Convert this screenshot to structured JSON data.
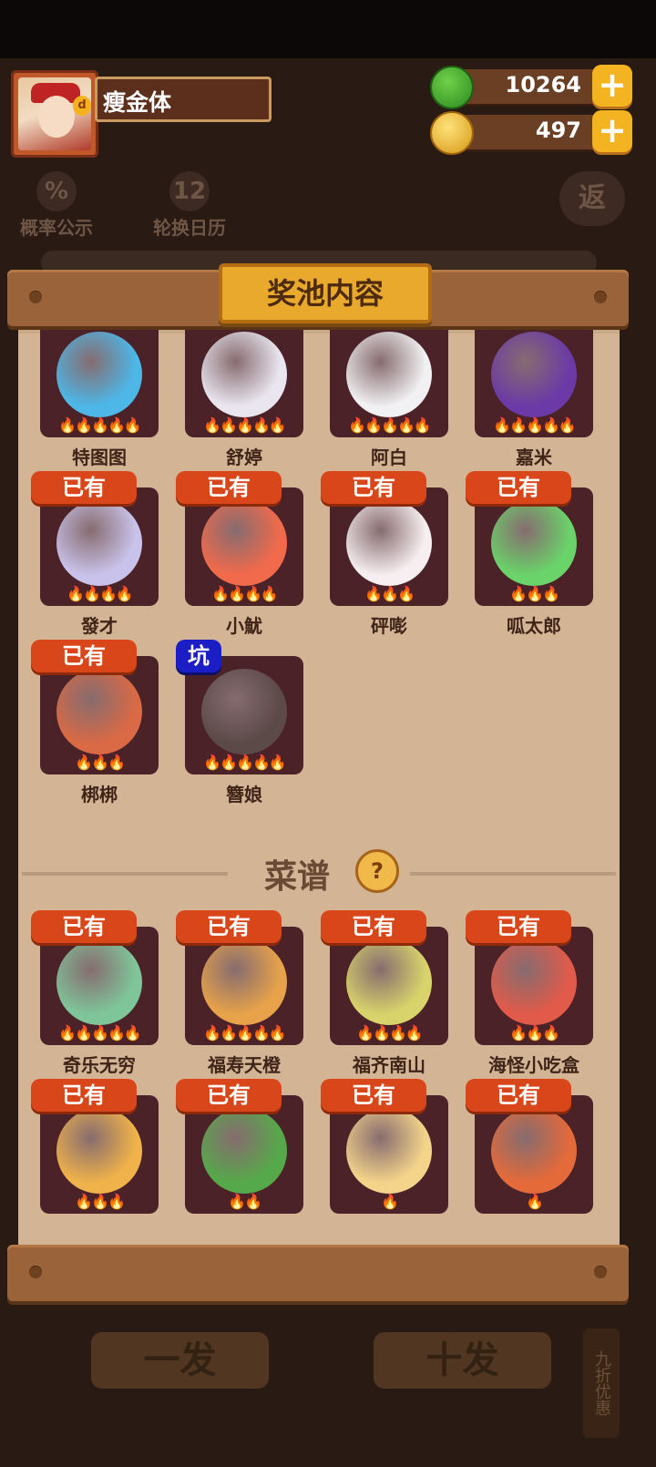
{
  "player": {
    "name": "瘦金体"
  },
  "currency": {
    "jade": {
      "value": "10264",
      "icon": "jade-coin-icon"
    },
    "coin": {
      "value": "497",
      "icon": "gold-coin-icon"
    },
    "add_symbol": "+"
  },
  "background_tools": {
    "rate": {
      "icon_text": "%",
      "label": "概率公示"
    },
    "calendar": {
      "icon_text": "12",
      "label": "轮换日历"
    },
    "back": {
      "label": "返"
    }
  },
  "background_buttons": {
    "single": "一发",
    "ten": "十发",
    "discount_tag": "九折优惠"
  },
  "modal": {
    "title": "奖池内容",
    "owned_tag": "已有",
    "pit_tag": "坑",
    "recipe_section_title": "菜谱",
    "help_symbol": "?",
    "characters": [
      {
        "name": "特图图",
        "owned": false,
        "stars": 5,
        "color": "#4db7e8"
      },
      {
        "name": "舒婷",
        "owned": false,
        "stars": 5,
        "color": "#eae6f0"
      },
      {
        "name": "阿白",
        "owned": false,
        "stars": 5,
        "color": "#f1f0f2"
      },
      {
        "name": "嘉米",
        "owned": false,
        "stars": 5,
        "color": "#6b3aa6"
      },
      {
        "name": "發才",
        "owned": true,
        "stars": 4,
        "color": "#c9c2ea"
      },
      {
        "name": "小魷",
        "owned": true,
        "stars": 4,
        "color": "#f26a4c"
      },
      {
        "name": "砰嘭",
        "owned": true,
        "stars": 3,
        "color": "#f6eef0"
      },
      {
        "name": "呱太郎",
        "owned": true,
        "stars": 3,
        "color": "#6ad36a"
      },
      {
        "name": "梆梆",
        "owned": true,
        "stars": 3,
        "color": "#d96a45"
      },
      {
        "name": "簪娘",
        "owned": false,
        "pit": true,
        "stars": 5,
        "color": "#5b4a48"
      }
    ],
    "recipes": [
      {
        "name": "奇乐无穷",
        "owned": true,
        "stars": 5,
        "color": "#7fc59a"
      },
      {
        "name": "福寿天橙",
        "owned": true,
        "stars": 5,
        "color": "#e7a24a"
      },
      {
        "name": "福齐南山",
        "owned": true,
        "stars": 4,
        "color": "#d9d36b"
      },
      {
        "name": "海怪小吃盒",
        "owned": true,
        "stars": 3,
        "color": "#e15a4a"
      },
      {
        "name": "",
        "owned": true,
        "stars": 3,
        "color": "#f0b24a"
      },
      {
        "name": "",
        "owned": true,
        "stars": 2,
        "color": "#56a94a"
      },
      {
        "name": "",
        "owned": true,
        "stars": 1,
        "color": "#f4d48a"
      },
      {
        "name": "",
        "owned": true,
        "stars": 1,
        "color": "#e46a3a"
      }
    ]
  }
}
